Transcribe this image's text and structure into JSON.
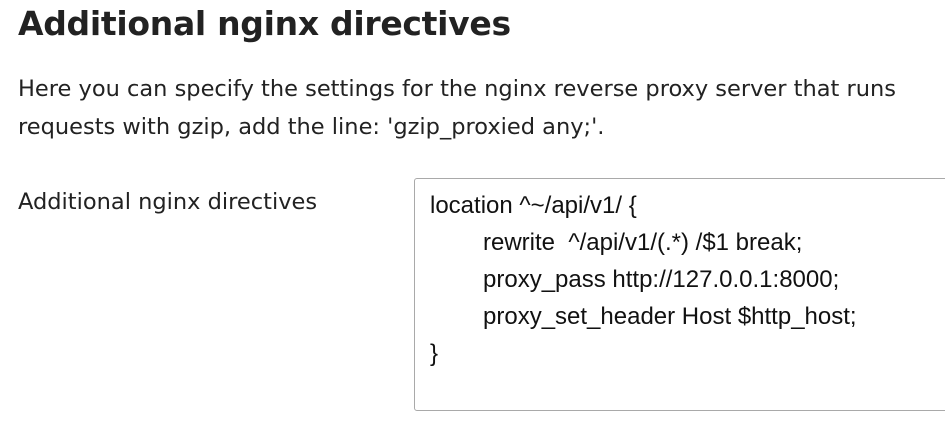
{
  "section": {
    "title": "Additional nginx directives",
    "description_lines": [
      "Here you can specify the settings for the nginx reverse proxy server that runs",
      "requests with gzip, add the line: 'gzip_proxied any;'."
    ]
  },
  "field": {
    "label": "Additional nginx directives",
    "value_lines": [
      "location ^~/api/v1/ {",
      "rewrite  ^/api/v1/(.*) /$1 break;",
      "proxy_pass http://127.0.0.1:8000;",
      "proxy_set_header Host $http_host;",
      "}"
    ]
  }
}
